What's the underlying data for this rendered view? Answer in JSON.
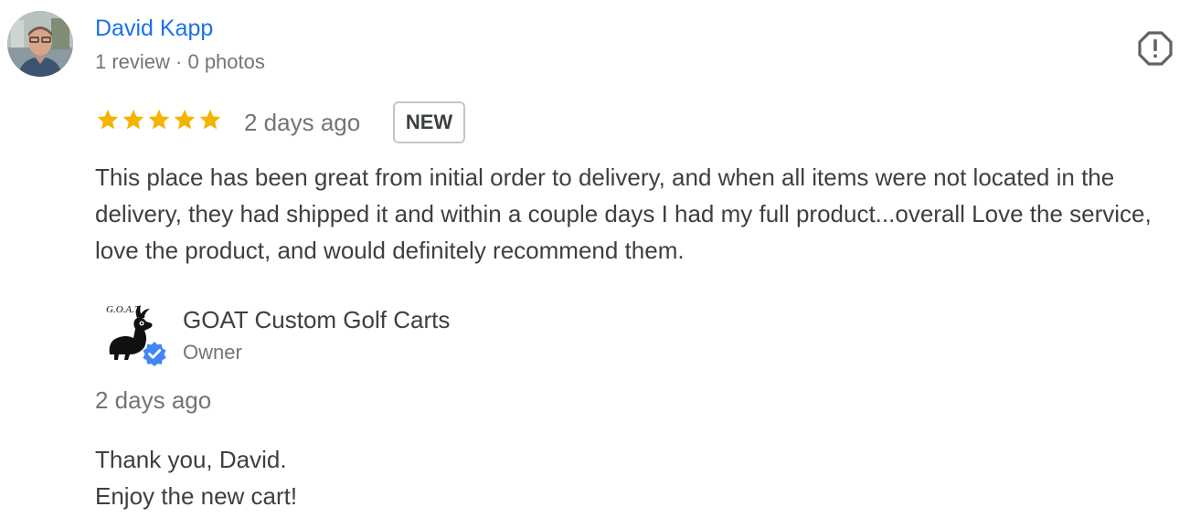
{
  "review": {
    "reviewer": {
      "name": "David Kapp",
      "meta": "1 review · 0 photos",
      "avatar_icon": "user-photo"
    },
    "report_icon": "report-flag-icon",
    "rating": 5,
    "star_color": "#f4b400",
    "date": "2 days ago",
    "badge": "NEW",
    "text": "This place has been great from initial order to delivery, and when all items were not located in the delivery, they had shipped it and within a couple days I had my full product...overall Love the service, love the product, and would definitely recommend them."
  },
  "owner_reply": {
    "owner_name": "GOAT Custom Golf Carts",
    "role": "Owner",
    "logo_icon": "goat-logo",
    "verified_icon": "verified-badge-icon",
    "verified_color": "#4285f4",
    "date": "2 days ago",
    "lines": [
      "Thank you, David.",
      "Enjoy the new cart!"
    ]
  },
  "colors": {
    "link_blue": "#1a73e8",
    "text_primary": "#3c4043",
    "text_secondary": "#70757a"
  }
}
